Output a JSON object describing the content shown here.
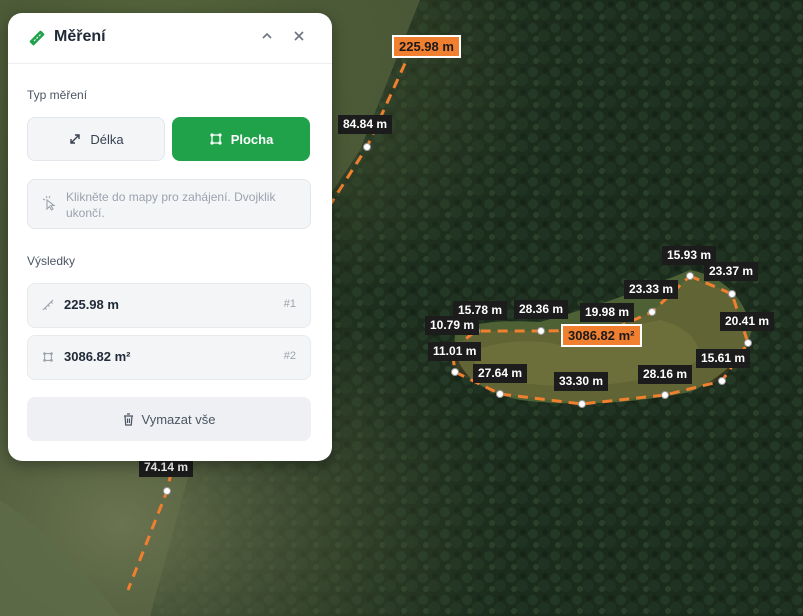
{
  "panel": {
    "title": "Měření",
    "type_label": "Typ měření",
    "btn_length": "Délka",
    "btn_area": "Plocha",
    "hint": "Klikněte do mapy pro zahájení. Dvojklik ukončí.",
    "results_label": "Výsledky",
    "results": [
      {
        "value": "225.98 m",
        "index": "#1",
        "icon": "ruler-line-icon"
      },
      {
        "value": "3086.82 m²",
        "index": "#2",
        "icon": "polygon-icon"
      }
    ],
    "clear_label": "Vymazat vše"
  },
  "map": {
    "line_total": "225.98 m",
    "line_segments": [
      "84.84 m",
      "74.14 m"
    ],
    "area_total": "3086.82 m²",
    "area_segments": [
      "15.93 m",
      "23.37 m",
      "23.33 m",
      "20.41 m",
      "15.78 m",
      "28.36 m",
      "19.98 m",
      "10.79 m",
      "11.01 m",
      "15.61 m",
      "27.64 m",
      "33.30 m",
      "28.16 m"
    ],
    "colors": {
      "measure_line": "#f07f2f",
      "active_button": "#1fa24a",
      "label_bg": "#1c1c1c"
    }
  }
}
